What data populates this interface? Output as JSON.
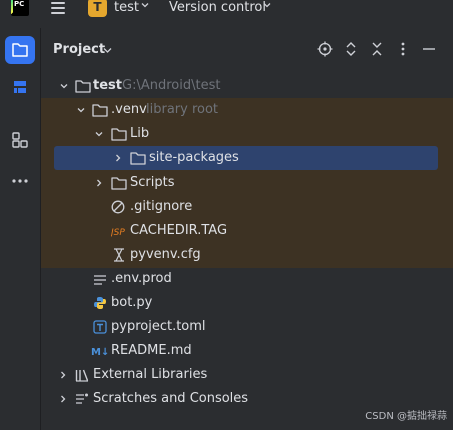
{
  "titlebar": {
    "app_logo_text": "PC",
    "project_badge": "T",
    "project_name": "test",
    "version_control": "Version control"
  },
  "panel": {
    "title": "Project"
  },
  "tree": {
    "root_name": "test",
    "root_path": "G:\\Android\\test",
    "venv_name": ".venv",
    "venv_hint": "library root",
    "lib": "Lib",
    "site_packages": "site-packages",
    "scripts": "Scripts",
    "gitignore": ".gitignore",
    "cachedir": "CACHEDIR.TAG",
    "pyvenv": "pyvenv.cfg",
    "env_prod": ".env.prod",
    "bot_py": "bot.py",
    "pyproject": "pyproject.toml",
    "readme": "README.md",
    "external_libraries": "External Libraries",
    "scratches": "Scratches and Consoles"
  },
  "colors": {
    "accent": "#3574f0",
    "selection": "#2e436e",
    "venv_highlight": "#3d3223",
    "badge": "#e5a72e"
  },
  "watermark": "CSDN @掂拙禄蒜"
}
